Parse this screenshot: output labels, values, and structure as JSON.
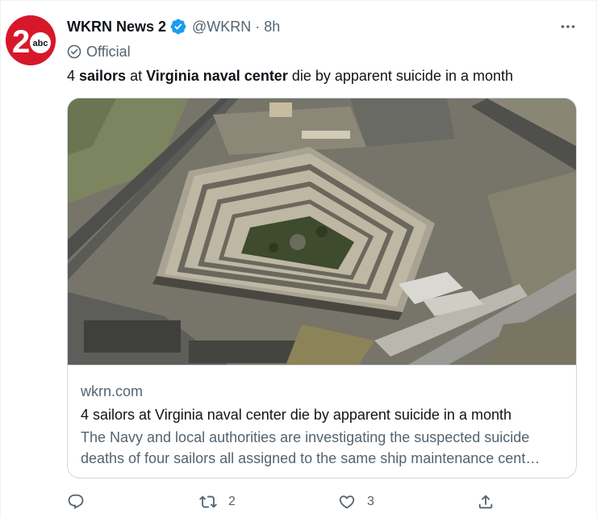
{
  "account": {
    "name": "WKRN News 2",
    "handle": "@WKRN",
    "separator": "·",
    "time": "8h",
    "label": "Official",
    "avatar_text": "2",
    "avatar_subtext": "abc"
  },
  "tweet": {
    "segments": [
      {
        "text": "4 ",
        "bold": false
      },
      {
        "text": "sailors",
        "bold": true
      },
      {
        "text": " at ",
        "bold": false
      },
      {
        "text": "Virginia naval center",
        "bold": true
      },
      {
        "text": " die by apparent suicide in a month",
        "bold": false
      }
    ]
  },
  "card": {
    "domain": "wkrn.com",
    "title": "4 sailors at Virginia naval center die by apparent suicide in a month",
    "description_line1": "The Navy and local authorities are investigating the suspected suicide",
    "description_line2": "deaths of four sailors all assigned to the same ship maintenance cent…"
  },
  "actions": {
    "retweets": "2",
    "likes": "3"
  },
  "colors": {
    "brand_red": "#d7182a",
    "verified_blue": "#1d9bf0",
    "secondary_text": "#536471",
    "border": "#cfd9de"
  },
  "icons": [
    "verified-badge-icon",
    "more-options-icon",
    "official-badge-icon",
    "reply-icon",
    "retweet-icon",
    "like-icon",
    "share-icon"
  ]
}
